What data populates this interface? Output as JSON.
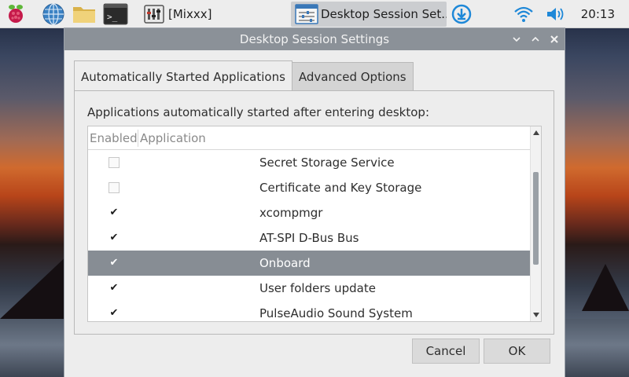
{
  "taskbar": {
    "tasks": [
      {
        "label": "[Mixxx]"
      },
      {
        "label": "Desktop Session Set..."
      }
    ],
    "clock": "20:13"
  },
  "dialog": {
    "title": "Desktop Session Settings",
    "tabs": [
      {
        "label": "Automatically Started Applications",
        "active": true
      },
      {
        "label": "Advanced Options",
        "active": false
      }
    ],
    "intro": "Applications automatically started after entering desktop:",
    "columns": {
      "enabled": "Enabled",
      "application": "Application"
    },
    "rows": [
      {
        "name": "Secret Storage Service",
        "enabled": false,
        "selected": false
      },
      {
        "name": "Certificate and Key Storage",
        "enabled": false,
        "selected": false
      },
      {
        "name": "xcompmgr",
        "enabled": true,
        "selected": false
      },
      {
        "name": "AT-SPI D-Bus Bus",
        "enabled": true,
        "selected": false
      },
      {
        "name": "Onboard",
        "enabled": true,
        "selected": true
      },
      {
        "name": "User folders update",
        "enabled": true,
        "selected": false
      },
      {
        "name": "PulseAudio Sound System",
        "enabled": true,
        "selected": false
      }
    ],
    "buttons": {
      "cancel": "Cancel",
      "ok": "OK"
    }
  },
  "colors": {
    "titlebar": "#8b9198",
    "selection": "#878d94",
    "accent_blue": "#1e88d8"
  },
  "icons": [
    "raspberry-pi-menu-icon",
    "web-browser-globe-icon",
    "file-manager-folder-icon",
    "terminal-icon",
    "mixxx-app-icon",
    "session-settings-icon",
    "download-icon",
    "wifi-icon",
    "volume-icon"
  ]
}
